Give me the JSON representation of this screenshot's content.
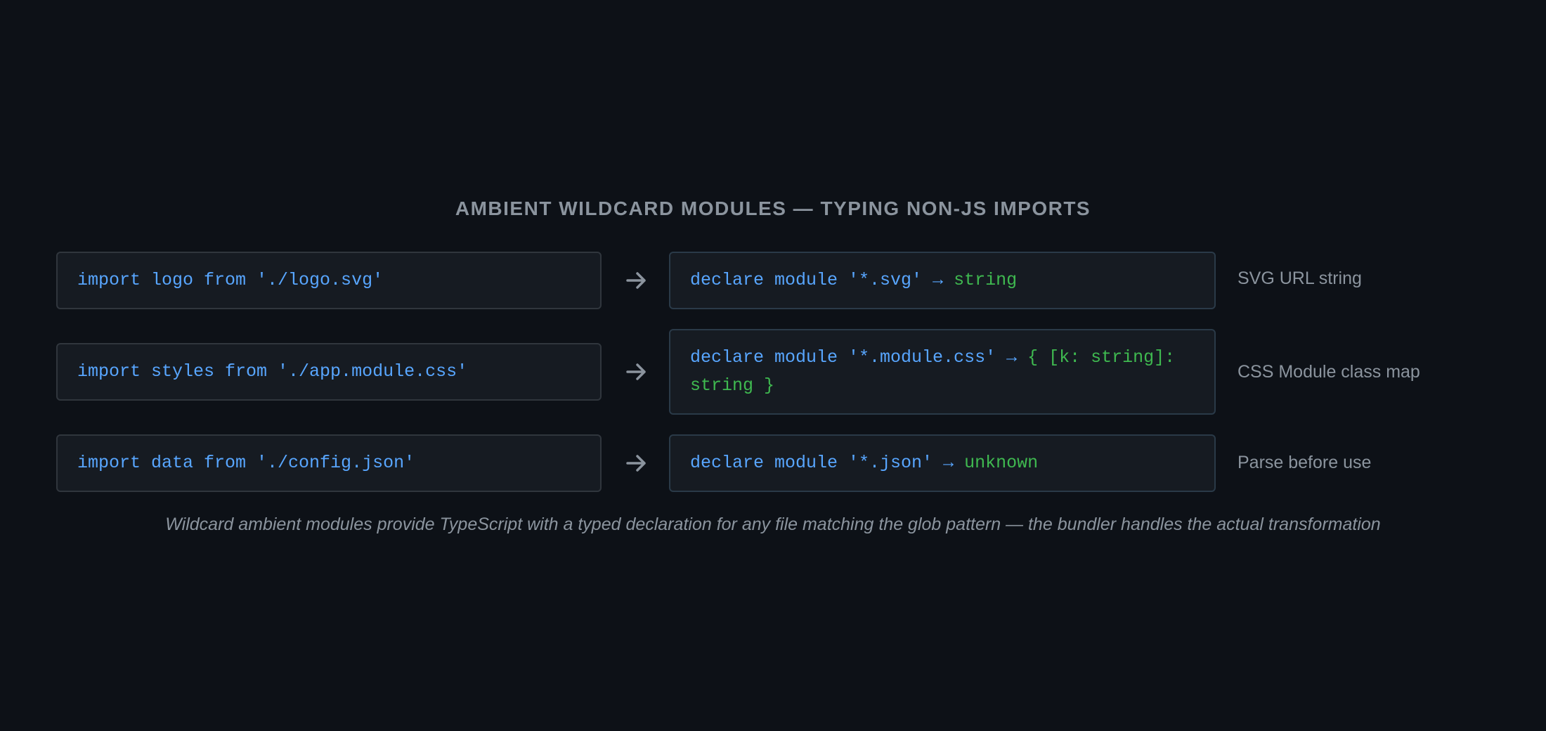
{
  "title": "AMBIENT WILDCARD MODULES — TYPING NON-JS IMPORTS",
  "rows": [
    {
      "import": "import logo from './logo.svg'",
      "declare": "declare module '*.svg'",
      "arrow": "→",
      "type": "string",
      "description": "SVG URL string"
    },
    {
      "import": "import styles from './app.module.css'",
      "declare": "declare module '*.module.css'",
      "arrow": "→",
      "type": "{ [k: string]: string }",
      "description": "CSS Module class map"
    },
    {
      "import": "import data from './config.json'",
      "declare": "declare module '*.json'",
      "arrow": "→",
      "type": "unknown",
      "description": "Parse before use"
    }
  ],
  "caption": "Wildcard ambient modules provide TypeScript with a typed declaration for any file matching the glob pattern — the bundler handles the actual transformation",
  "colors": {
    "background": "#0d1117",
    "box": "#161b22",
    "border": "#30363d",
    "code": "#58a6ff",
    "type": "#3fb950",
    "muted": "#8b949e"
  },
  "icons": {
    "connector": "right-arrow-icon"
  }
}
